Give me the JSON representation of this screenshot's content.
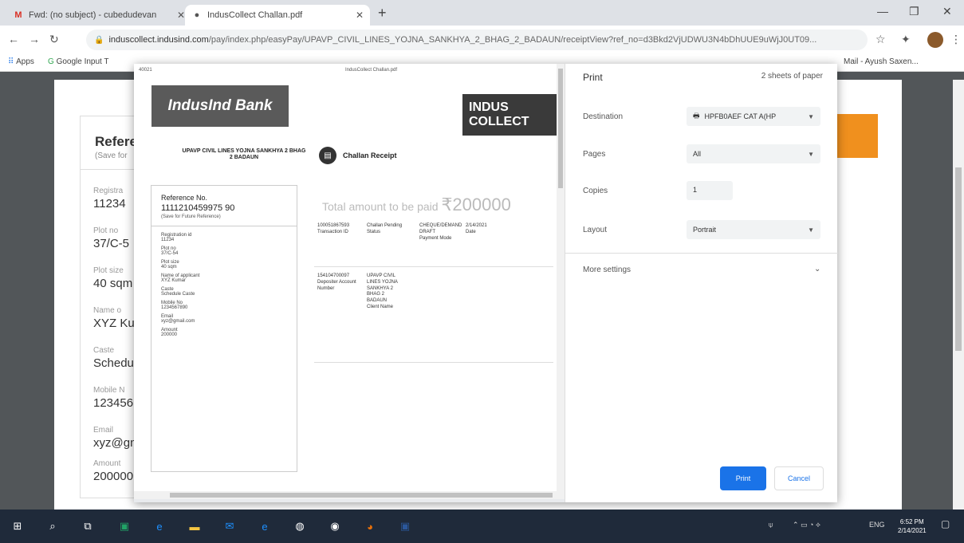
{
  "browser": {
    "tabs": [
      {
        "label": "Fwd: (no subject) - cubedudevan",
        "active": false,
        "icon": "gmail-icon"
      },
      {
        "label": "IndusCollect Challan.pdf",
        "active": true,
        "icon": "globe-icon"
      }
    ],
    "url_host": "induscollect.indusind.com",
    "url_path": "/pay/index.php/easyPay/UPAVP_CIVIL_LINES_YOJNA_SANKHYA_2_BHAG_2_BADAUN/receiptView?ref_no=d3Bkd2VjUDWU3N4bDhUUE9uWjJ0UT09...",
    "bookmarks": [
      "Apps",
      "Google Input T",
      "Mail - Ayush Saxen..."
    ]
  },
  "background_form": {
    "title": "Refere",
    "subtitle": "(Save for",
    "fields": [
      {
        "label": "Registra",
        "value": "11234"
      },
      {
        "label": "Plot no",
        "value": "37/C-5"
      },
      {
        "label": "Plot size",
        "value": "40 sqm"
      },
      {
        "label": "Name o",
        "value": "XYZ Kui"
      },
      {
        "label": "Caste",
        "value": "Schedul"
      },
      {
        "label": "Mobile N",
        "value": "123456"
      },
      {
        "label": "Email",
        "value": "xyz@gn"
      },
      {
        "label": "Amount",
        "value": "200000"
      }
    ]
  },
  "preview": {
    "header_left": "40021",
    "header_center": "IndusCollect Challan.pdf",
    "bank_name": "IndusInd Bank",
    "collect_logo": "INDUS COLLECT",
    "org_name": "UPAVP CIVIL LINES YOJNA SANKHYA 2 BHAG 2 BADAUN",
    "receipt_title": "Challan Receipt",
    "reference_label": "Reference No.",
    "reference_number": "1111210459975 90",
    "reference_note": "(Save for Future Reference)",
    "total_label": "Total amount to be paid",
    "total_amount": "₹200000",
    "details": {
      "txn_id": "100051867593",
      "txn_id_label": "Transaction ID",
      "status": "Challan Pending",
      "status_label": "Status",
      "payment_mode": "CHEQUE/DEMAND DRAFT",
      "payment_mode_label": "Payment Mode",
      "date": "2/14/2021",
      "date_label": "Date",
      "depositer_account": "154104700097",
      "depositer_label": "Depositer Account Number",
      "client_name": "UPAVP CIVIL LINES YOJNA SANKHYA 2 BHAG 2 BADAUN",
      "client_label": "Client Name"
    },
    "fields": [
      {
        "label": "Registration id",
        "value": "11234"
      },
      {
        "label": "Plot no",
        "value": "37/C-54"
      },
      {
        "label": "Plot size",
        "value": "40 sqm"
      },
      {
        "label": "Name of applicant",
        "value": "XYZ Kumar"
      },
      {
        "label": "Caste",
        "value": "Schedule Caste"
      },
      {
        "label": "Mobile No",
        "value": "1234567890"
      },
      {
        "label": "Email",
        "value": "xyz@gmail.com"
      },
      {
        "label": "Amount",
        "value": "200000"
      }
    ]
  },
  "print": {
    "title": "Print",
    "sheets": "2 sheets of paper",
    "destination_label": "Destination",
    "destination_value": "HPFB0AEF CAT A(HP",
    "pages_label": "Pages",
    "pages_value": "All",
    "copies_label": "Copies",
    "copies_value": "1",
    "layout_label": "Layout",
    "layout_value": "Portrait",
    "more_settings": "More settings",
    "print_button": "Print",
    "cancel_button": "Cancel"
  },
  "taskbar": {
    "tray_lang": "ENG",
    "time": "6:52 PM",
    "date": "2/14/2021"
  }
}
